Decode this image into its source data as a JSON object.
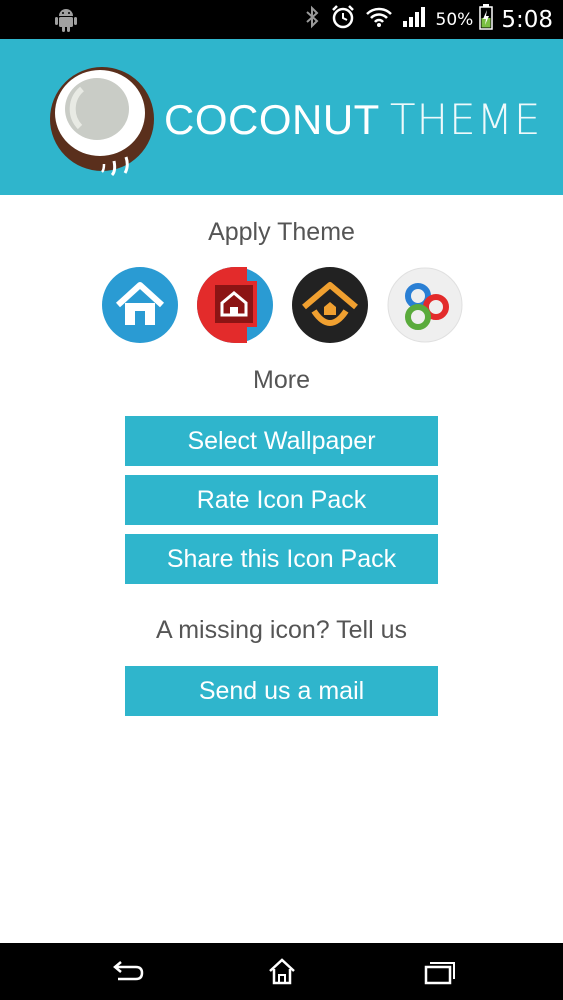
{
  "status_bar": {
    "battery_percent": "50%",
    "time": "5:08",
    "icons": [
      "android-icon",
      "bluetooth-icon",
      "alarm-icon",
      "wifi-icon",
      "signal-icon",
      "battery-charging-icon"
    ]
  },
  "header": {
    "title_bold": "COCONUT",
    "title_light": "THEME",
    "background_color": "#2fb5cc",
    "logo_icon": "coconut-logo-icon"
  },
  "apply_section": {
    "heading": "Apply Theme",
    "launchers": [
      {
        "icon": "blue-home-launcher-icon"
      },
      {
        "icon": "red-home-launcher-icon"
      },
      {
        "icon": "orange-home-launcher-icon"
      },
      {
        "icon": "go-launcher-icon"
      }
    ]
  },
  "more_section": {
    "heading": "More",
    "buttons": {
      "wallpaper": "Select Wallpaper",
      "rate": "Rate Icon Pack",
      "share": "Share this Icon Pack"
    }
  },
  "missing_section": {
    "heading": "A missing icon? Tell us",
    "mail_button": "Send us a mail"
  },
  "nav_bar": {
    "icons": [
      "back-icon",
      "home-icon",
      "recent-apps-icon"
    ]
  }
}
